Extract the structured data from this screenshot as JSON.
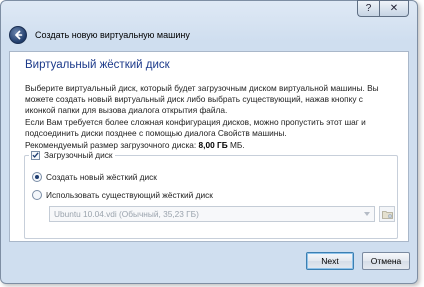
{
  "titlebar": {
    "help_glyph": "?",
    "close_glyph": "✕"
  },
  "header": {
    "window_title": "Создать новую виртуальную машину"
  },
  "page": {
    "title": "Виртуальный жёсткий диск",
    "paragraph1": "Выберите виртуальный диск, который будет загрузочным диском виртуальной машины. Вы можете создать новый виртуальный диск либо выбрать существующий, нажав кнопку с иконкой папки для вызова диалога открытия файла.",
    "paragraph2": "Если Вам требуется более сложная конфигурация дисков, можно пропустить этот шаг и подсоединить диски позднее с помощью диалога Свойств машины.",
    "recommended_label": "Рекомендуемый размер загрузочного диска:",
    "recommended_value": "8,00 ГБ",
    "recommended_suffix": " МБ."
  },
  "boot_disk": {
    "checkbox_label": "Загрузочный диск",
    "checked": true,
    "option_create": "Создать новый жёсткий диск",
    "option_existing": "Использовать существующий жёсткий диск",
    "selected_option": "create",
    "existing_disk_value": "Ubuntu 10.04.vdi (Обычный, 35,23 ГБ)"
  },
  "footer": {
    "next_label": "Next",
    "cancel_label": "Отмена"
  },
  "colors": {
    "title_accent": "#1c3a8a",
    "window_bg": "#cfdeef"
  }
}
